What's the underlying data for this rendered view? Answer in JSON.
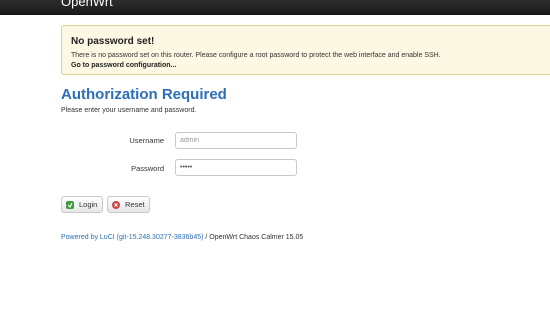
{
  "header": {
    "brand": "OpenWrt"
  },
  "alert": {
    "title": "No password set!",
    "text": "There is no password set on this router. Please configure a root password to protect the web interface and enable SSH.",
    "link": "Go to password configuration..."
  },
  "auth": {
    "title": "Authorization Required",
    "subtitle": "Please enter your username and password.",
    "username_label": "Username",
    "username_value": "admin",
    "password_label": "Password",
    "password_value": "admin"
  },
  "buttons": {
    "login": "Login",
    "reset": "Reset"
  },
  "footer": {
    "luci_link": "Powered by LuCI (git-15.248.30277-3836b45)",
    "separator": " / ",
    "version": "OpenWrt Chaos Calmer 15.05"
  },
  "icons": {
    "login": "login-icon",
    "reset": "reset-icon"
  },
  "colors": {
    "accent": "#2b6fb6",
    "alert_bg": "#fcf8e3",
    "topbar": "#222222"
  }
}
